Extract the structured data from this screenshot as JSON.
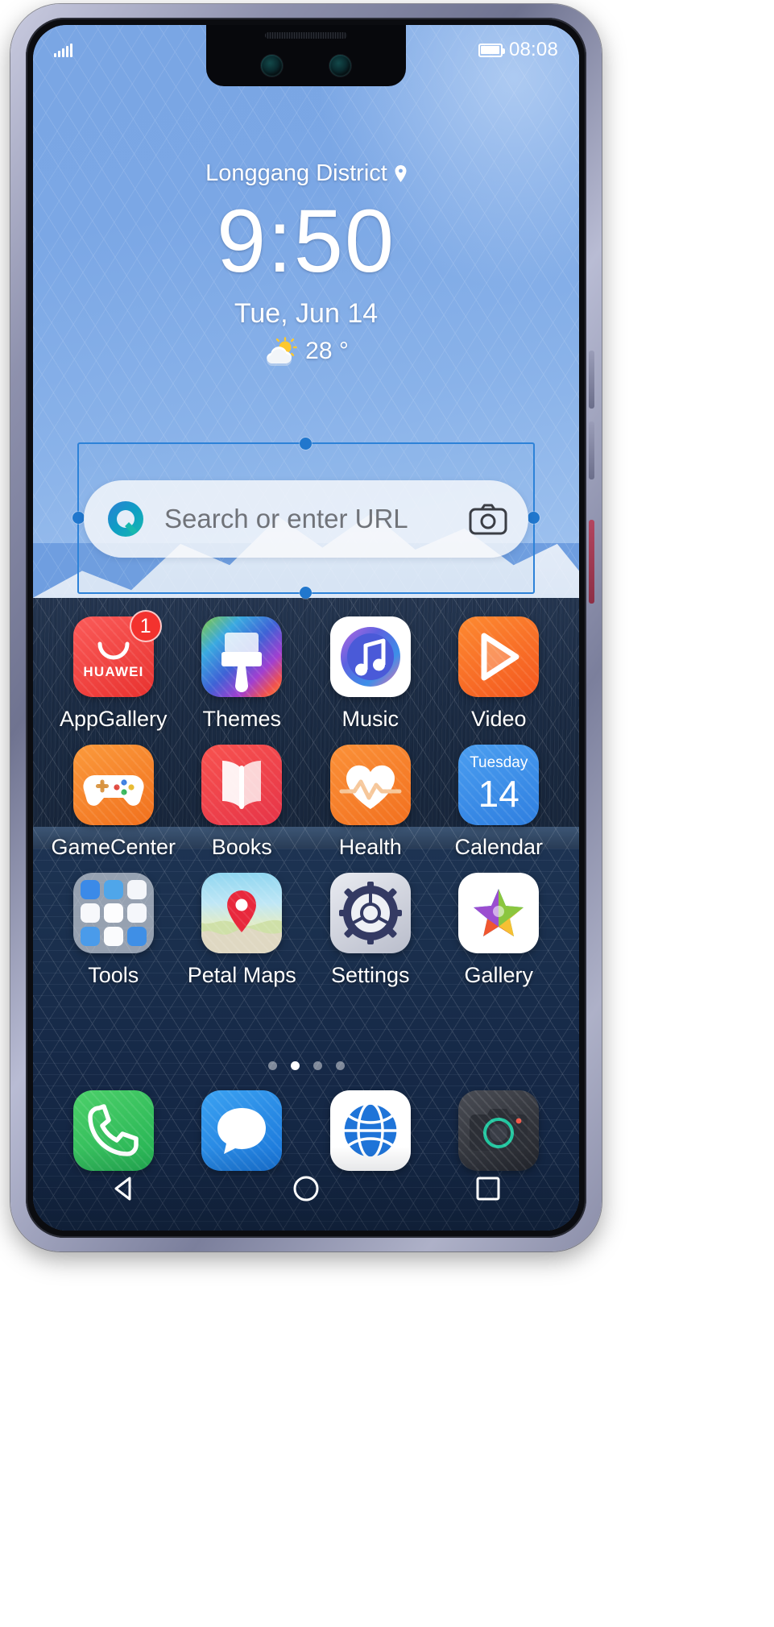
{
  "status_bar": {
    "signal_icon": "signal-bars-icon",
    "battery_icon": "battery-icon",
    "time": "08:08"
  },
  "clock_widget": {
    "location": "Longgang District",
    "location_icon": "location-pin-icon",
    "time": "9:50",
    "date": "Tue, Jun 14",
    "weather_icon": "sun-behind-cloud-icon",
    "temperature": "28 °"
  },
  "search_widget": {
    "logo_icon": "petal-search-logo-icon",
    "placeholder": "Search or enter URL",
    "camera_icon": "camera-search-icon",
    "selected": true,
    "handle_color": "#2177cd",
    "border_color": "#2d82d8"
  },
  "app_grid": {
    "rows": [
      [
        {
          "label": "AppGallery",
          "icon": "appgallery-icon",
          "badge": "1",
          "brand_text": "HUAWEI"
        },
        {
          "label": "Themes",
          "icon": "themes-icon",
          "badge": ""
        },
        {
          "label": "Music",
          "icon": "music-icon",
          "badge": ""
        },
        {
          "label": "Video",
          "icon": "video-icon",
          "badge": ""
        }
      ],
      [
        {
          "label": "GameCenter",
          "icon": "gamecenter-icon",
          "badge": ""
        },
        {
          "label": "Books",
          "icon": "books-icon",
          "badge": ""
        },
        {
          "label": "Health",
          "icon": "health-icon",
          "badge": ""
        },
        {
          "label": "Calendar",
          "icon": "calendar-icon",
          "badge": "",
          "cal_dow": "Tuesday",
          "cal_day": "14"
        }
      ],
      [
        {
          "label": "Tools",
          "icon": "tools-folder-icon",
          "badge": ""
        },
        {
          "label": "Petal Maps",
          "icon": "petal-maps-icon",
          "badge": ""
        },
        {
          "label": "Settings",
          "icon": "settings-gear-icon",
          "badge": ""
        },
        {
          "label": "Gallery",
          "icon": "gallery-icon",
          "badge": ""
        }
      ]
    ]
  },
  "page_indicator": {
    "count": 4,
    "active_index": 1
  },
  "dock": {
    "items": [
      {
        "label": "Phone",
        "icon": "phone-icon"
      },
      {
        "label": "Messages",
        "icon": "messages-icon"
      },
      {
        "label": "Browser",
        "icon": "browser-globe-icon"
      },
      {
        "label": "Camera",
        "icon": "camera-icon"
      }
    ]
  },
  "nav_bar": {
    "back": "back-triangle-icon",
    "home": "home-circle-icon",
    "recents": "recents-square-icon"
  },
  "device": {
    "notch_cameras": [
      "front-camera-left",
      "front-camera-right"
    ],
    "earpiece": "earpiece-speaker"
  }
}
